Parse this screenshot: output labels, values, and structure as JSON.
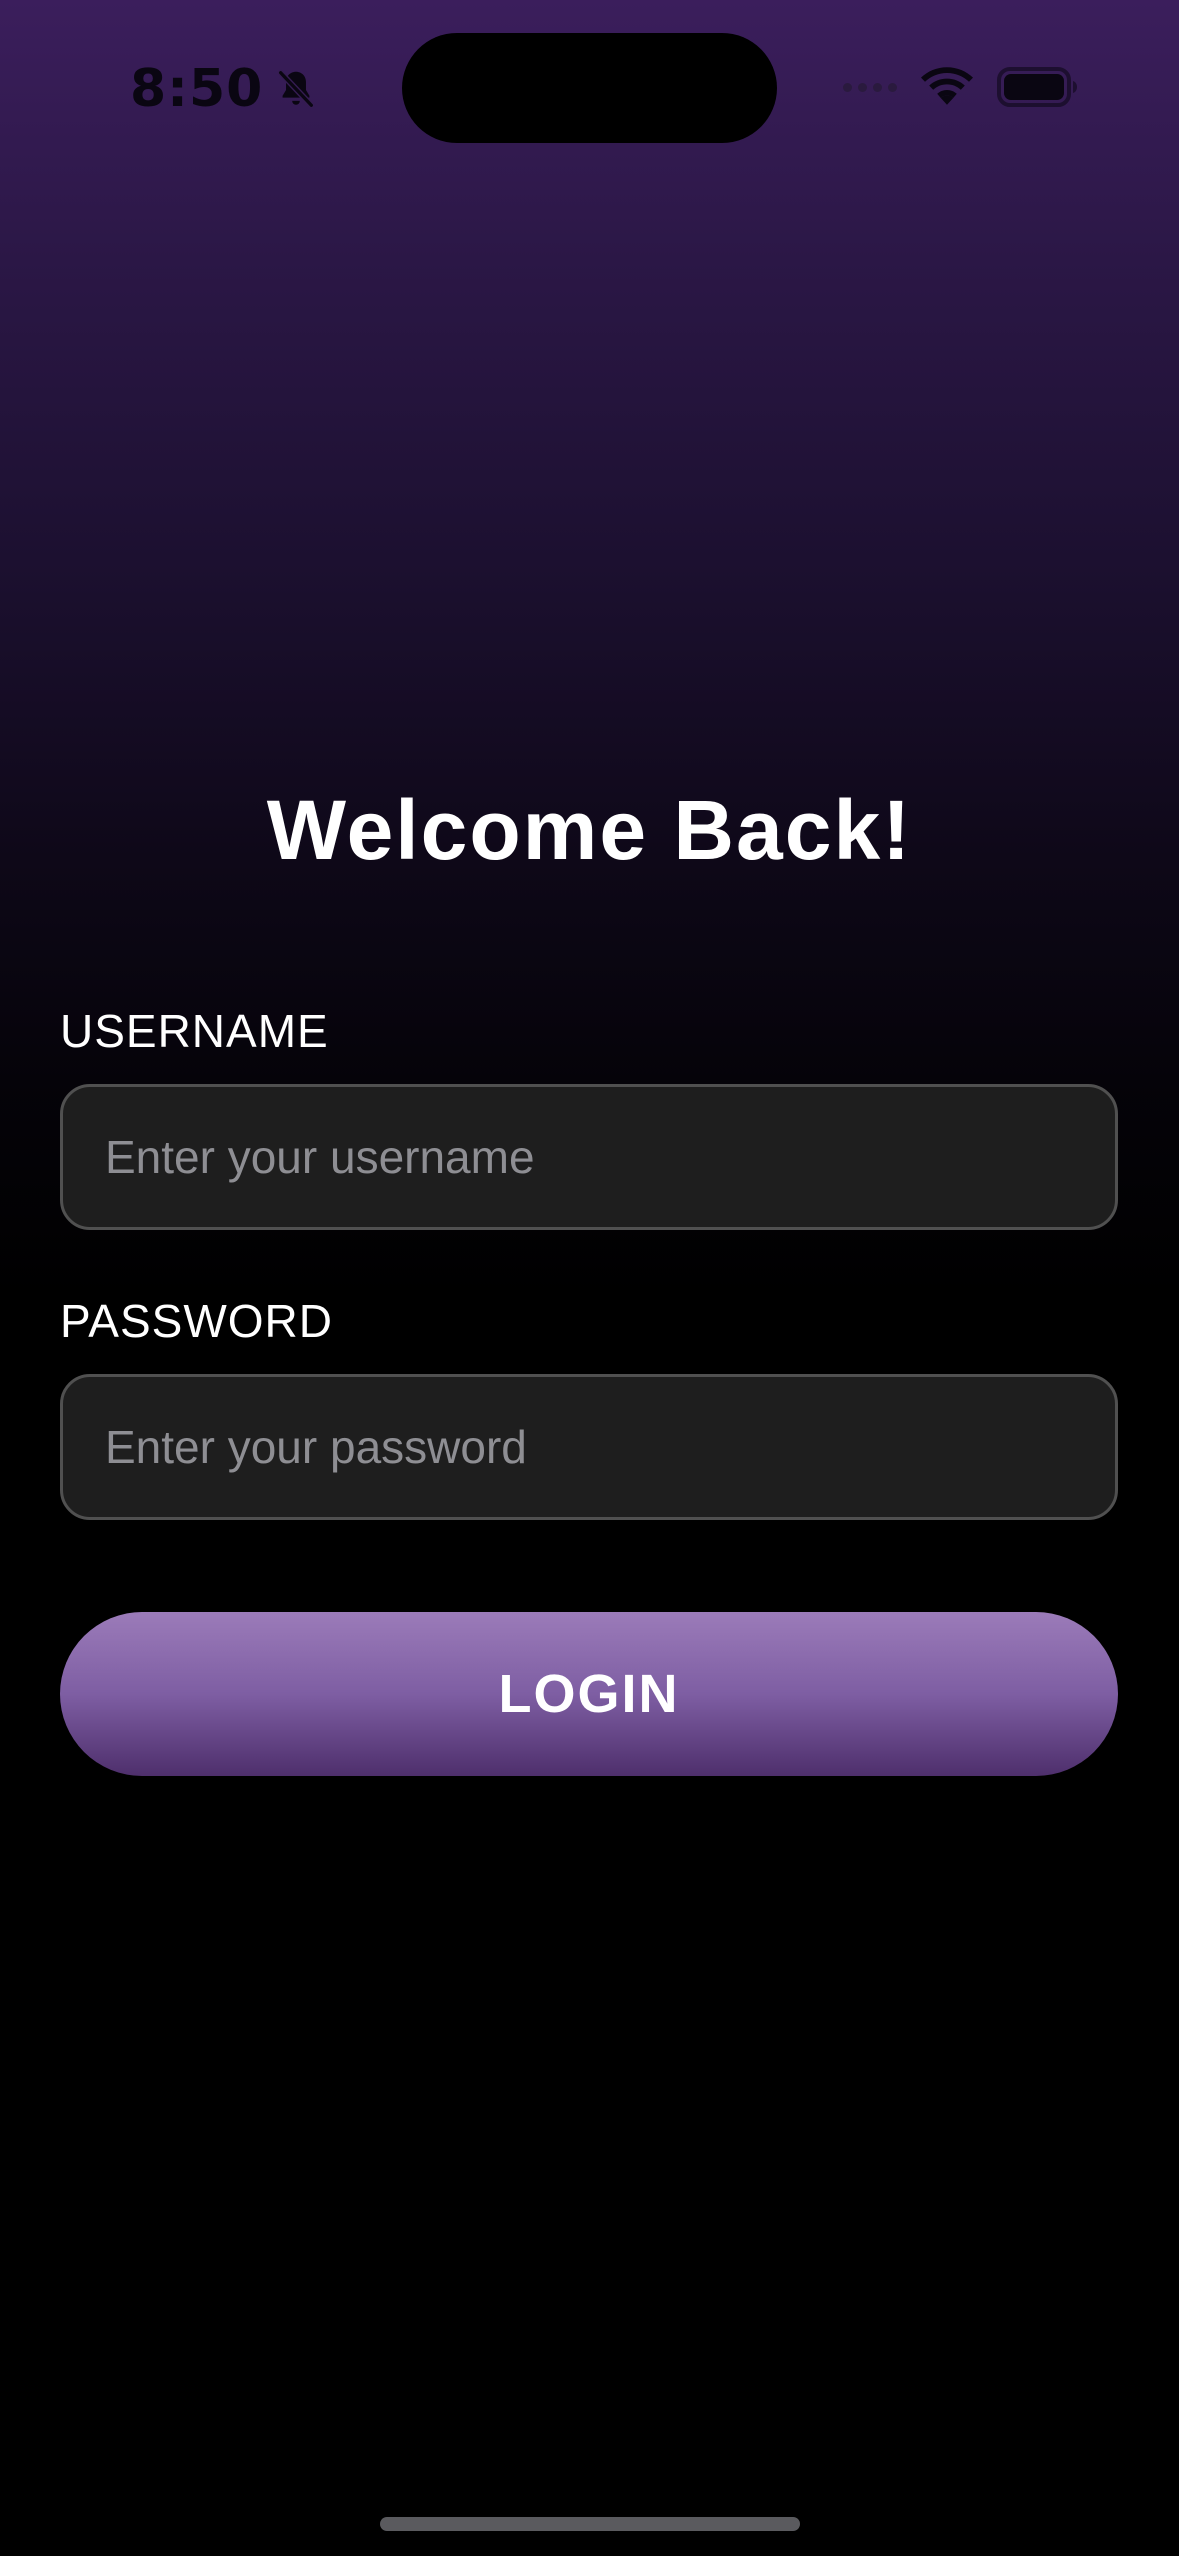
{
  "status_bar": {
    "time": "8:50",
    "icons": {
      "silent": "bell-slash-icon",
      "signal": "cellular-signal-icon",
      "wifi": "wifi-icon",
      "battery": "battery-icon"
    }
  },
  "login": {
    "title": "Welcome Back!",
    "username": {
      "label": "USERNAME",
      "value": "",
      "placeholder": "Enter your username"
    },
    "password": {
      "label": "PASSWORD",
      "value": "",
      "placeholder": "Enter your password"
    },
    "button_label": "LOGIN"
  },
  "colors": {
    "background_top": "#3b1e5c",
    "background_bottom": "#000000",
    "button_top": "#9b7bb9",
    "button_bottom": "#4e2f6c",
    "input_background": "#1e1e1e",
    "input_border": "#505050",
    "placeholder": "#8e8e93"
  }
}
